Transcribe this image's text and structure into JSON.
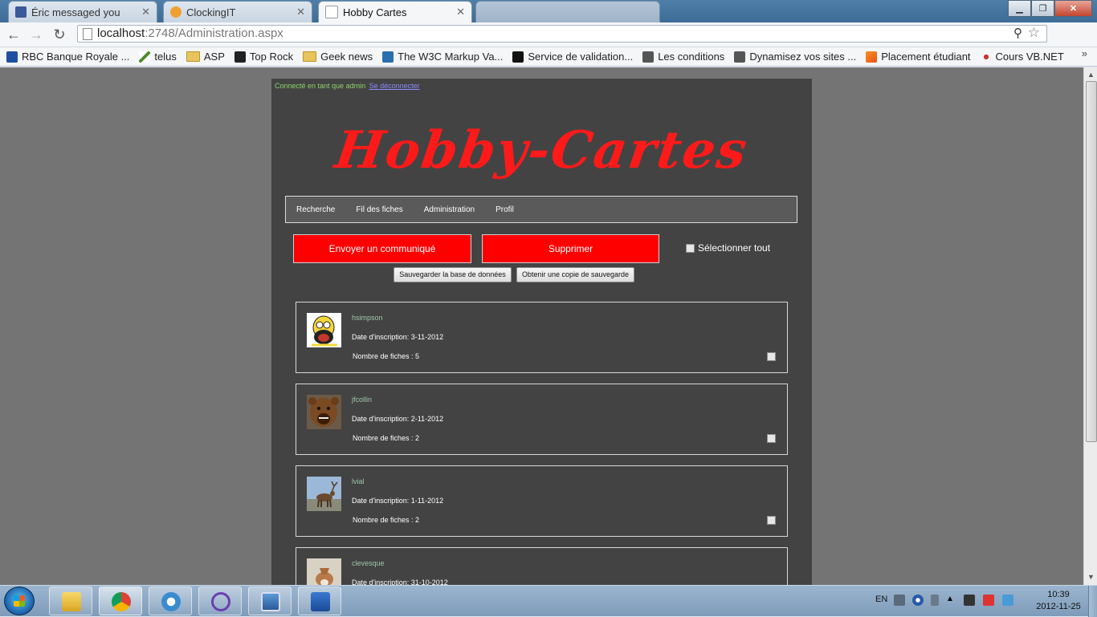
{
  "browser": {
    "tabs": [
      {
        "title": "Éric messaged you",
        "color": "#3b5998"
      },
      {
        "title": "ClockingIT",
        "color": "#f0a030"
      },
      {
        "title": "Hobby Cartes",
        "color": "#ffffff"
      }
    ],
    "url_host": "localhost",
    "url_path": ":2748/Administration.aspx",
    "bookmarks": [
      "RBC Banque Royale ...",
      "telus",
      "ASP",
      "Top Rock",
      "Geek news",
      "The W3C Markup Va...",
      "Service de validation...",
      "Les conditions",
      "Dynamisez vos sites ...",
      "Placement étudiant",
      "Cours VB.NET"
    ],
    "bookmarks_more": "»"
  },
  "page": {
    "login_text": "Connecté en tant que admin",
    "logout_link": "Se déconnecter",
    "logo": "Hobby-Cartes",
    "menu": [
      "Recherche",
      "Fil des fiches",
      "Administration",
      "Profil"
    ],
    "send_button": "Envoyer un communiqué",
    "delete_button": "Supprimer",
    "select_all": "Sélectionner tout",
    "backup_button": "Sauvegarder la base de données",
    "copy_button": "Obtenir une copie de sauvegarde",
    "users": [
      {
        "username": "hsimpson",
        "date": "Date d'inscription: 3-11-2012",
        "count": "Nombre de fiches : 5"
      },
      {
        "username": "jfcollin",
        "date": "Date d'inscription: 2-11-2012",
        "count": "Nombre de fiches : 2"
      },
      {
        "username": "lvial",
        "date": "Date d'inscription: 1-11-2012",
        "count": "Nombre de fiches : 2"
      },
      {
        "username": "clevesque",
        "date": "Date d'inscription: 31-10-2012",
        "count": ""
      }
    ]
  },
  "taskbar": {
    "language": "EN",
    "time": "10:39",
    "date": "2012-11-25"
  },
  "colors": {
    "accent_red": "#ff0000",
    "page_bg": "#434343",
    "viewport_bg": "#747474",
    "username_green": "#9fc6a8"
  }
}
